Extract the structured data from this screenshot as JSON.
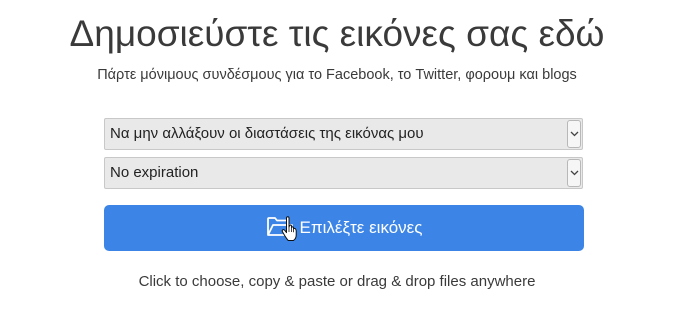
{
  "header": {
    "title": "Δημοσιεύστε τις εικόνες σας εδώ",
    "subtitle": "Πάρτε μόνιμους συνδέσμους για το Facebook, το Twitter, φορουμ και blogs"
  },
  "form": {
    "resize_select": {
      "selected": "Να μην αλλάξουν οι διαστάσεις της εικόνας μου"
    },
    "expiration_select": {
      "selected": "No expiration"
    },
    "upload_button": {
      "label": "Επιλέξτε εικόνες",
      "icon": "folder-open-icon",
      "color": "#3c85e6"
    }
  },
  "hint": "Click to choose, copy & paste or drag & drop files anywhere"
}
